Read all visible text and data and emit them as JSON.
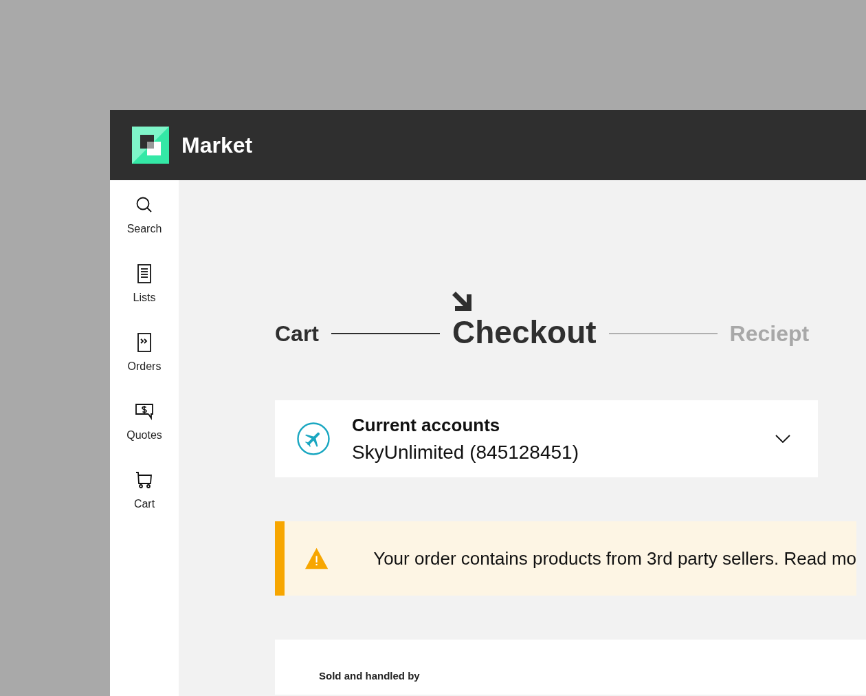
{
  "header": {
    "title": "Market"
  },
  "sidebar": {
    "items": [
      {
        "kind": "search",
        "label": "Search"
      },
      {
        "kind": "lists",
        "label": "Lists"
      },
      {
        "kind": "orders",
        "label": "Orders"
      },
      {
        "kind": "quotes",
        "label": "Quotes"
      },
      {
        "kind": "cart",
        "label": "Cart"
      }
    ]
  },
  "steps": [
    {
      "label": "Cart",
      "completed": true,
      "selected": false
    },
    {
      "label": "Checkout",
      "completed": false,
      "selected": true
    },
    {
      "label": "Reciept",
      "completed": false,
      "selected": false
    }
  ],
  "account": {
    "label": "Current accounts",
    "value": "SkyUnlimited (845128451)"
  },
  "alert": {
    "text": "Your order contains products from 3rd party sellers. Read mo"
  },
  "seller_card": {
    "heading": "Sold and handled by"
  }
}
